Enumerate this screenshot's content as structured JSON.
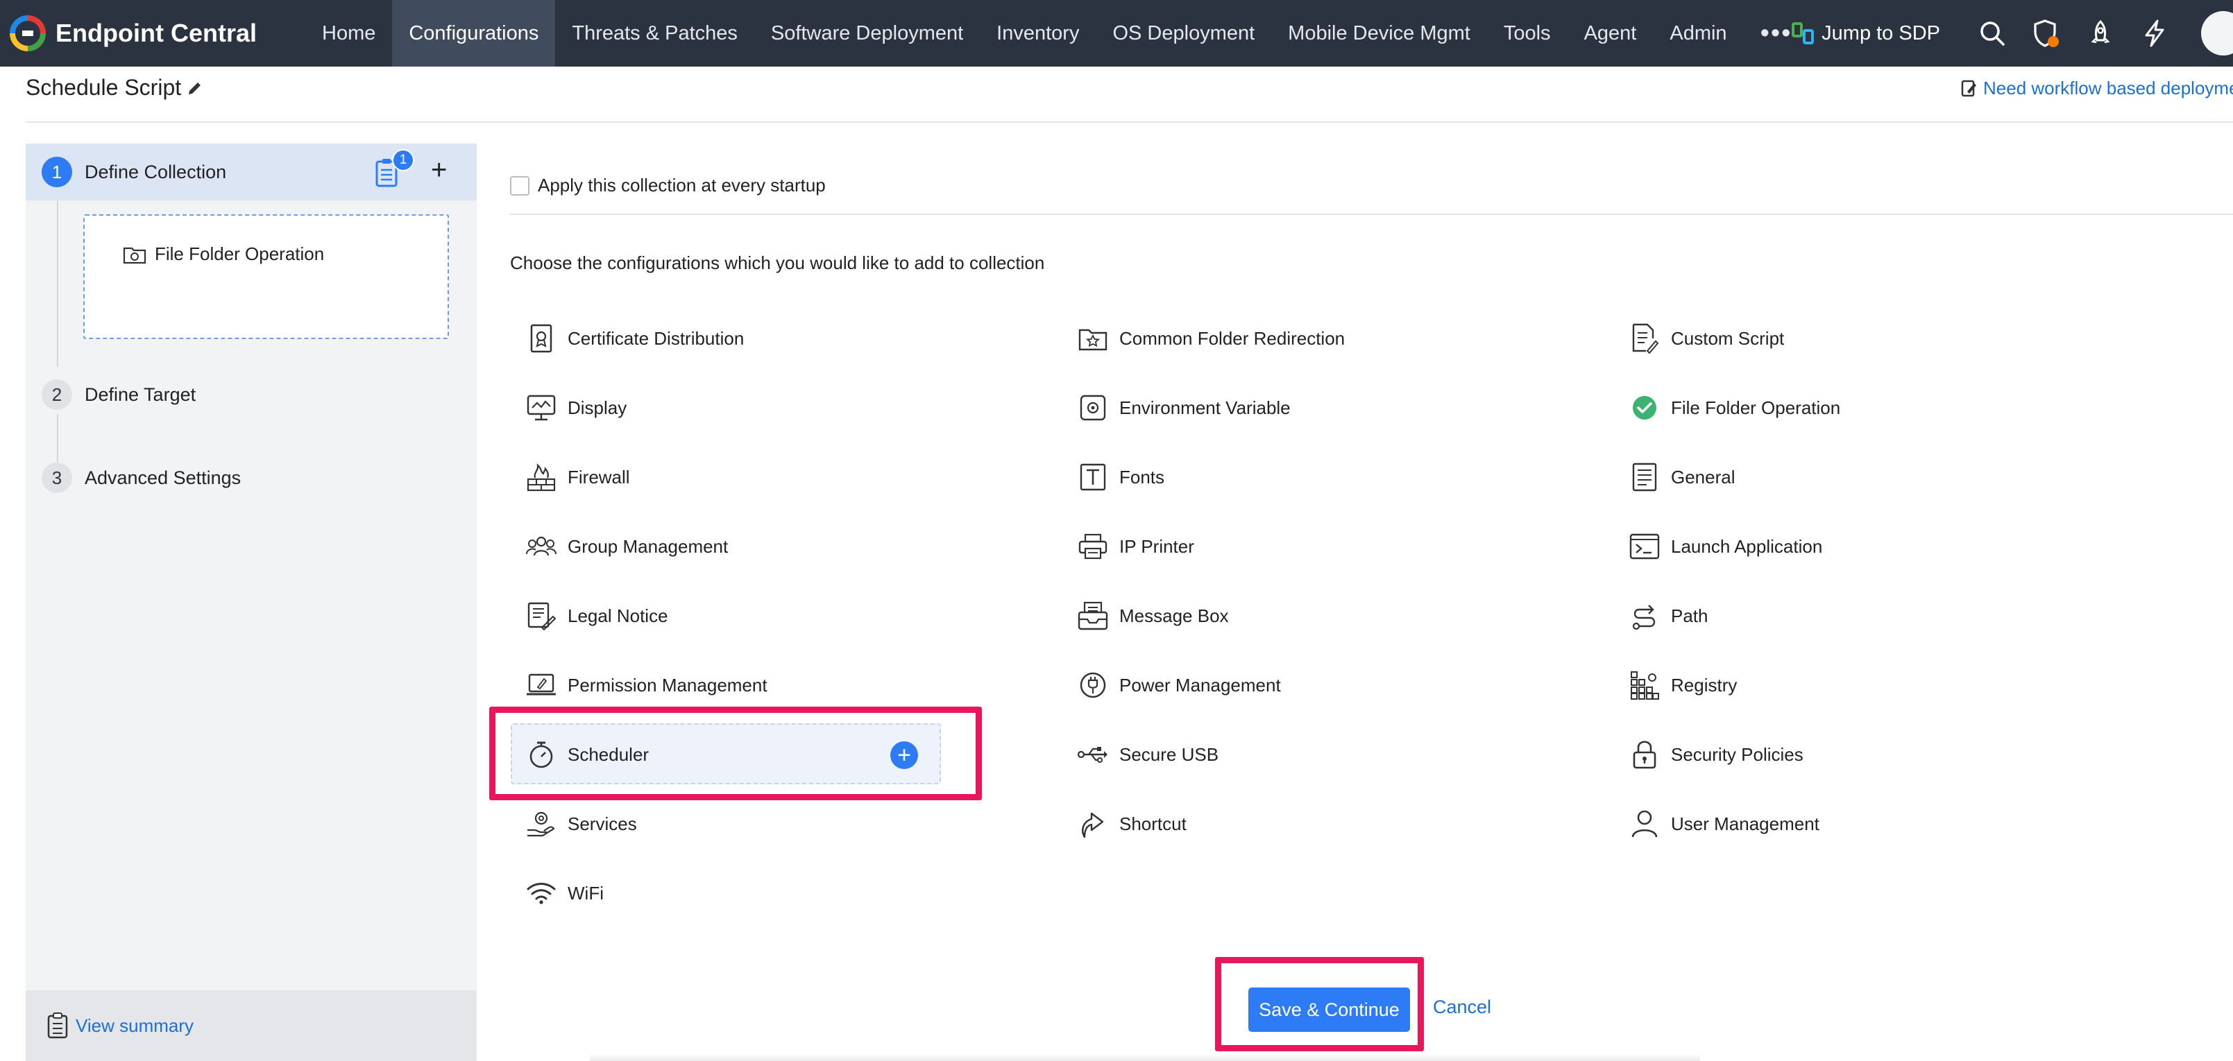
{
  "brand": {
    "name": "Endpoint Central"
  },
  "nav": [
    {
      "label": "Home",
      "active": false
    },
    {
      "label": "Configurations",
      "active": true
    },
    {
      "label": "Threats & Patches",
      "active": false
    },
    {
      "label": "Software Deployment",
      "active": false
    },
    {
      "label": "Inventory",
      "active": false
    },
    {
      "label": "OS Deployment",
      "active": false
    },
    {
      "label": "Mobile Device Mgmt",
      "active": false
    },
    {
      "label": "Tools",
      "active": false
    },
    {
      "label": "Agent",
      "active": false
    },
    {
      "label": "Admin",
      "active": false
    }
  ],
  "nav_more": "•••",
  "tools": {
    "jump_label": "Jump to SDP"
  },
  "page": {
    "title": "Schedule Script",
    "workflow_link": "Need workflow based deployme"
  },
  "steps": [
    {
      "num": "1",
      "label": "Define Collection"
    },
    {
      "num": "2",
      "label": "Define Target"
    },
    {
      "num": "3",
      "label": "Advanced Settings"
    }
  ],
  "collection": {
    "badge": "1",
    "added_item": "File Folder Operation"
  },
  "summary": {
    "link": "View summary"
  },
  "main": {
    "apply_label": "Apply this collection at every startup",
    "choose_text": "Choose the configurations which you would like to add to collection",
    "configs": [
      {
        "label": "Certificate Distribution",
        "icon": "certificate-icon"
      },
      {
        "label": "Common Folder Redirection",
        "icon": "folder-redirect-icon"
      },
      {
        "label": "Custom Script",
        "icon": "script-icon"
      },
      {
        "label": "Display",
        "icon": "display-icon"
      },
      {
        "label": "Environment Variable",
        "icon": "environment-icon"
      },
      {
        "label": "File Folder Operation",
        "icon": "check-circle-icon"
      },
      {
        "label": "Firewall",
        "icon": "firewall-icon"
      },
      {
        "label": "Fonts",
        "icon": "fonts-icon"
      },
      {
        "label": "General",
        "icon": "general-icon"
      },
      {
        "label": "Group Management",
        "icon": "group-icon"
      },
      {
        "label": "IP Printer",
        "icon": "printer-icon"
      },
      {
        "label": "Launch Application",
        "icon": "terminal-icon"
      },
      {
        "label": "Legal Notice",
        "icon": "legal-notice-icon"
      },
      {
        "label": "Message Box",
        "icon": "message-box-icon"
      },
      {
        "label": "Path",
        "icon": "path-icon"
      },
      {
        "label": "Permission Management",
        "icon": "permission-icon"
      },
      {
        "label": "Power Management",
        "icon": "power-icon"
      },
      {
        "label": "Registry",
        "icon": "registry-icon"
      },
      {
        "label": "Scheduler",
        "icon": "timer-icon"
      },
      {
        "label": "Secure USB",
        "icon": "usb-icon"
      },
      {
        "label": "Security Policies",
        "icon": "lock-icon"
      },
      {
        "label": "Services",
        "icon": "services-icon"
      },
      {
        "label": "Shortcut",
        "icon": "shortcut-icon"
      },
      {
        "label": "User Management",
        "icon": "user-icon"
      },
      {
        "label": "WiFi",
        "icon": "wifi-icon"
      }
    ],
    "add_symbol": "+"
  },
  "actions": {
    "save": "Save & Continue",
    "cancel": "Cancel"
  },
  "colors": {
    "accent": "#2d7cf6",
    "navbar": "#2c3340",
    "highlight": "#e8175d",
    "success": "#3cb371"
  }
}
